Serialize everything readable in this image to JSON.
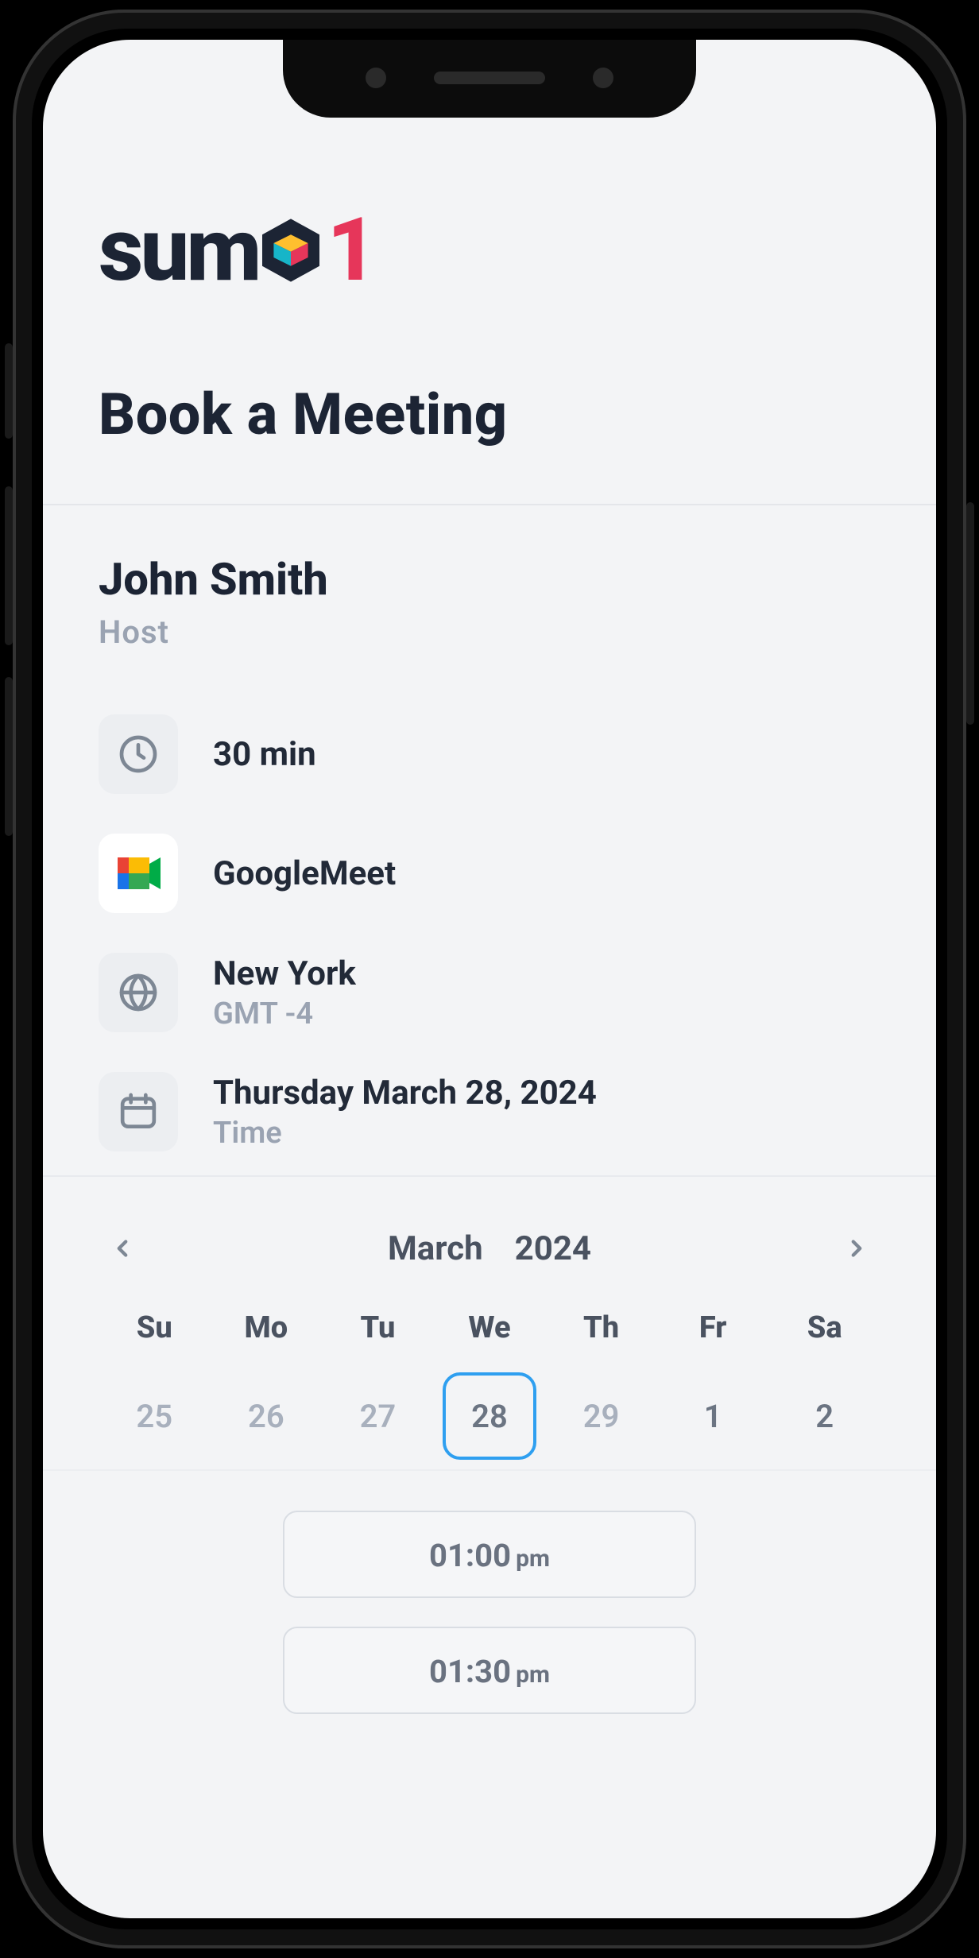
{
  "logo": {
    "text": "sum",
    "suffix": "1"
  },
  "page_title": "Book a Meeting",
  "host": {
    "name": "John Smith",
    "role": "Host"
  },
  "details": {
    "duration": "30 min",
    "platform": "GoogleMeet",
    "location": {
      "city": "New York",
      "tz": "GMT -4"
    },
    "date": {
      "label": "Thursday March 28, 2024",
      "sub": "Time"
    }
  },
  "calendar": {
    "month_label": "March",
    "year_label": "2024",
    "dow": [
      "Su",
      "Mo",
      "Tu",
      "We",
      "Th",
      "Fr",
      "Sa"
    ],
    "days": [
      {
        "n": "25",
        "inMonth": false,
        "selected": false
      },
      {
        "n": "26",
        "inMonth": false,
        "selected": false
      },
      {
        "n": "27",
        "inMonth": false,
        "selected": false
      },
      {
        "n": "28",
        "inMonth": false,
        "selected": true
      },
      {
        "n": "29",
        "inMonth": false,
        "selected": false
      },
      {
        "n": "1",
        "inMonth": true,
        "selected": false
      },
      {
        "n": "2",
        "inMonth": true,
        "selected": false
      }
    ]
  },
  "slots": [
    {
      "time": "01:00",
      "ampm": "pm"
    },
    {
      "time": "01:30",
      "ampm": "pm"
    }
  ]
}
